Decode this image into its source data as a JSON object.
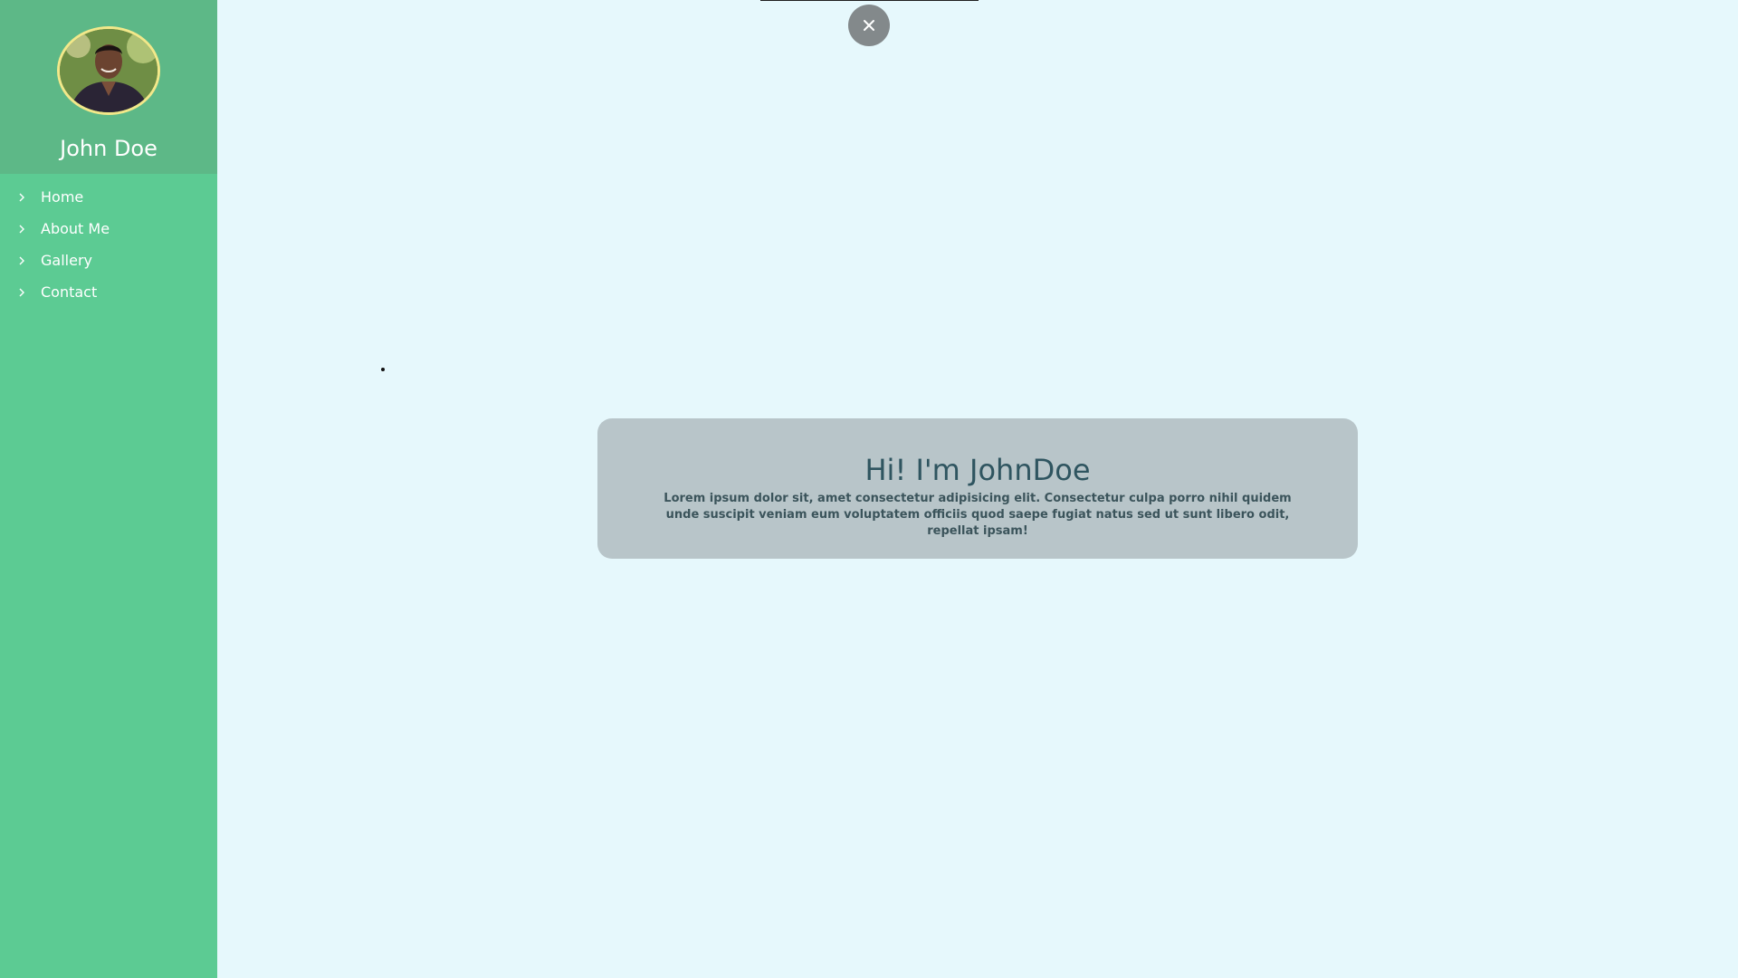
{
  "sidebar": {
    "profile_name": "John Doe",
    "avatar_icon": "person-avatar-icon",
    "items": [
      {
        "label": "Home",
        "icon": "chevron-right-icon"
      },
      {
        "label": "About Me",
        "icon": "chevron-right-icon"
      },
      {
        "label": "Gallery",
        "icon": "chevron-right-icon"
      },
      {
        "label": "Contact",
        "icon": "chevron-right-icon"
      }
    ]
  },
  "close_button": {
    "icon": "close-icon"
  },
  "hero": {
    "title": "Hi! I'm JohnDoe",
    "text": "Lorem ipsum dolor sit, amet consectetur adipisicing elit. Consectetur culpa porro nihil quidem unde suscipit veniam eum voluptatem officiis quod saepe fugiat natus sed ut sunt libero odit, repellat ipsam!"
  },
  "colors": {
    "sidebar": "#5ccb93",
    "profile_header": "#5db887",
    "page_background": "#e6f8fc",
    "hero_card": "#b8c5c9",
    "hero_title": "#2f5560",
    "close_button": "#83898b",
    "avatar_ring": "#f2e88a"
  }
}
